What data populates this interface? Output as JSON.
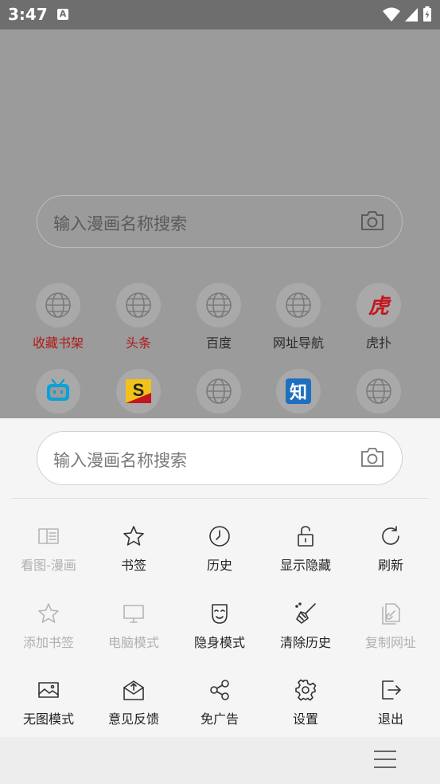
{
  "status_bar": {
    "time": "3:47",
    "app_icon_letter": "A"
  },
  "background": {
    "search_placeholder": "输入漫画名称搜索",
    "shortcuts": [
      {
        "label": "收藏书架",
        "icon": "globe-icon",
        "red": true
      },
      {
        "label": "头条",
        "icon": "globe-icon",
        "red": true
      },
      {
        "label": "百度",
        "icon": "globe-icon"
      },
      {
        "label": "网址导航",
        "icon": "globe-icon"
      },
      {
        "label": "虎扑",
        "icon": "hupu-icon",
        "glyph": "虎"
      },
      {
        "label": "",
        "icon": "bilibili-icon"
      },
      {
        "label": "",
        "icon": "sohu-icon",
        "glyph": "S"
      },
      {
        "label": "",
        "icon": "globe-icon"
      },
      {
        "label": "",
        "icon": "zhihu-icon",
        "glyph": "知"
      },
      {
        "label": "",
        "icon": "globe-icon"
      }
    ]
  },
  "sheet": {
    "search_placeholder": "输入漫画名称搜索",
    "menu": [
      {
        "label": "看图-漫画",
        "icon": "book-icon",
        "disabled": true
      },
      {
        "label": "书签",
        "icon": "star-icon"
      },
      {
        "label": "历史",
        "icon": "clock-icon"
      },
      {
        "label": "显示隐藏",
        "icon": "unlock-icon"
      },
      {
        "label": "刷新",
        "icon": "refresh-icon"
      },
      {
        "label": "添加书签",
        "icon": "star-outline-icon",
        "disabled": true
      },
      {
        "label": "电脑模式",
        "icon": "monitor-icon",
        "disabled": true
      },
      {
        "label": "隐身模式",
        "icon": "mask-icon"
      },
      {
        "label": "清除历史",
        "icon": "broom-icon"
      },
      {
        "label": "复制网址",
        "icon": "copy-link-icon",
        "disabled": true
      },
      {
        "label": "无图模式",
        "icon": "image-icon"
      },
      {
        "label": "意见反馈",
        "icon": "feedback-mail-icon"
      },
      {
        "label": "免广告",
        "icon": "share-icon"
      },
      {
        "label": "设置",
        "icon": "gear-icon"
      },
      {
        "label": "退出",
        "icon": "exit-icon"
      }
    ]
  },
  "colors": {
    "dim_bg": "#9b9b9b",
    "status_bar": "#6e6e6e",
    "red_label": "#b01818",
    "disabled": "#b0b0b0"
  }
}
